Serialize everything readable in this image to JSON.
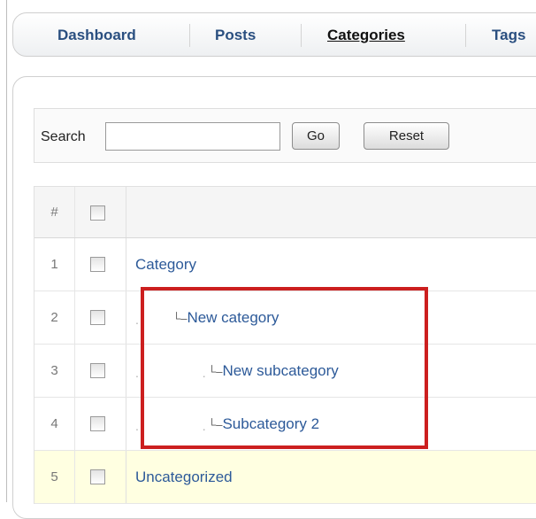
{
  "tabs": [
    {
      "label": "Dashboard",
      "active": false
    },
    {
      "label": "Posts",
      "active": false
    },
    {
      "label": "Categories",
      "active": true
    },
    {
      "label": "Tags",
      "active": false
    }
  ],
  "search": {
    "label": "Search",
    "value": "",
    "go_label": "Go",
    "reset_label": "Reset"
  },
  "table": {
    "header_num": "#",
    "rows": [
      {
        "num": "1",
        "name": "Category",
        "branch": "",
        "dots": ""
      },
      {
        "num": "2",
        "name": "New category",
        "branch": "└–",
        "dots": "."
      },
      {
        "num": "3",
        "name": "New subcategory",
        "branch": "└–",
        "dots": ". ."
      },
      {
        "num": "4",
        "name": "Subcategory 2",
        "branch": "└–",
        "dots": ". ."
      },
      {
        "num": "5",
        "name": "Uncategorized",
        "branch": "",
        "dots": ""
      }
    ]
  },
  "colors": {
    "link": "#2d5a99",
    "highlight_box": "#cc1f1f",
    "selected_row": "#ffffe1"
  }
}
